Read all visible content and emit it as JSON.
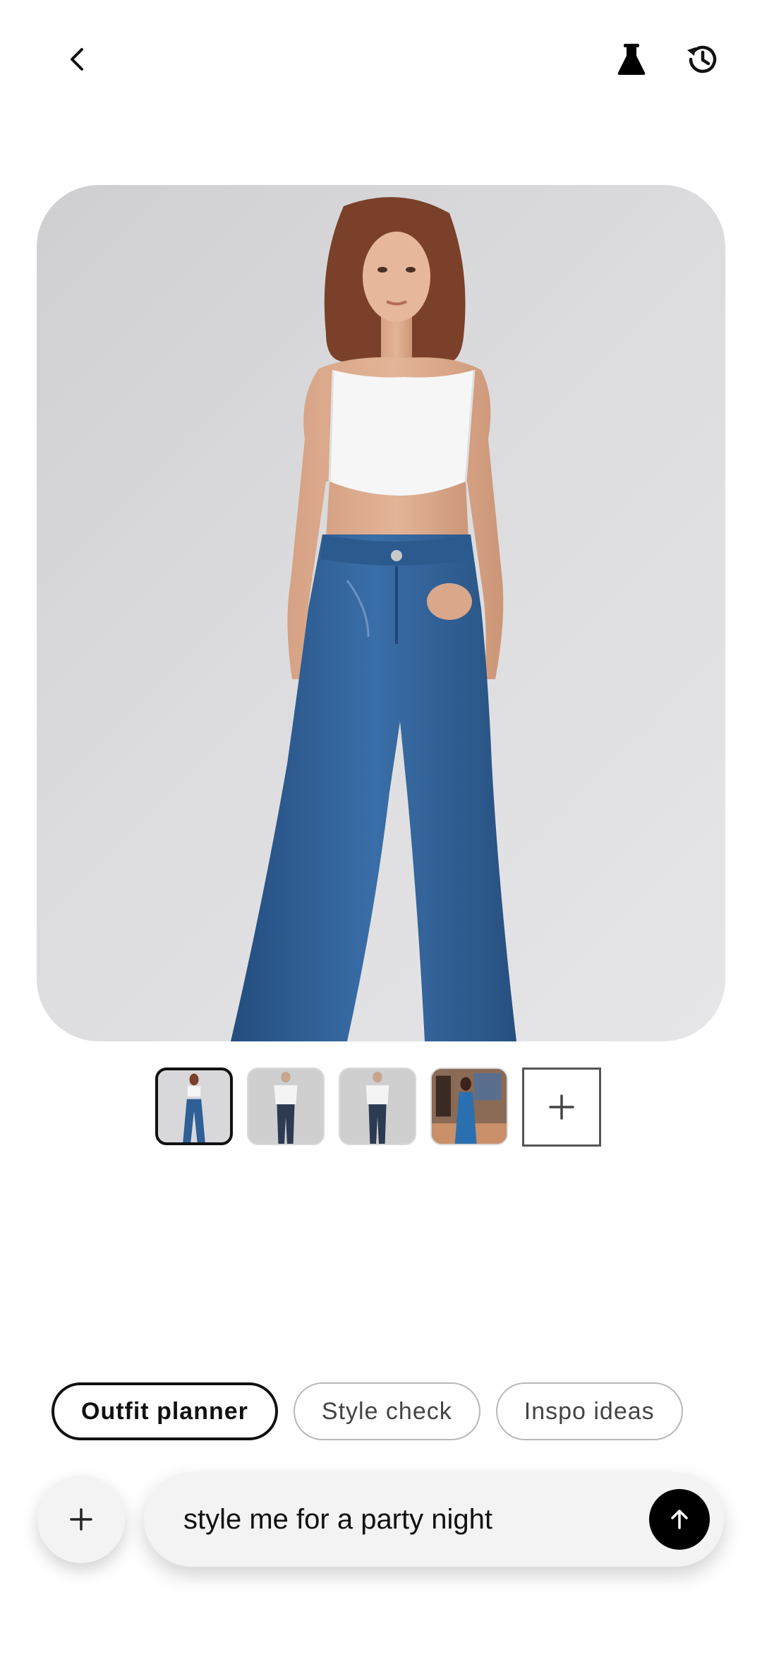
{
  "header": {
    "back_icon": "chevron-left-icon",
    "lab_icon": "flask-icon",
    "history_icon": "history-icon"
  },
  "hero": {
    "image": "woman-in-white-crop-top-and-flared-jeans"
  },
  "thumbnails": [
    {
      "name": "thumb-white-crop-top-flared-jeans",
      "selected": true
    },
    {
      "name": "thumb-white-tee-dark-jeans-1",
      "selected": false
    },
    {
      "name": "thumb-white-tee-dark-jeans-2",
      "selected": false
    },
    {
      "name": "thumb-blue-dress-boutique",
      "selected": false
    }
  ],
  "chips": [
    {
      "label": "Outfit planner",
      "active": true
    },
    {
      "label": "Style check",
      "active": false
    },
    {
      "label": "Inspo ideas",
      "active": false
    }
  ],
  "composer": {
    "value": "style me for a party night",
    "add_icon": "plus-icon",
    "send_icon": "arrow-up-icon"
  },
  "colors": {
    "accent": "#000000",
    "denim": "#2f5f97",
    "background": "#ffffff"
  }
}
